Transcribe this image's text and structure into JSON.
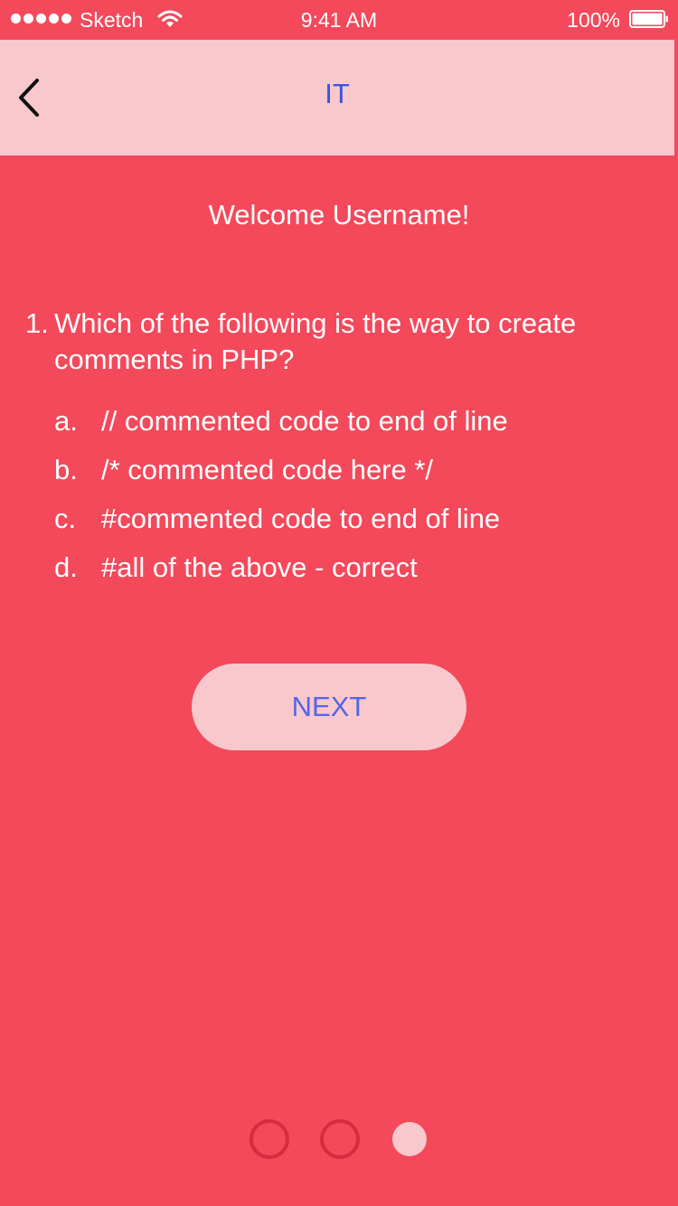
{
  "status_bar": {
    "carrier": "Sketch",
    "time": "9:41 AM",
    "battery_percent": "100%",
    "battery_level": 1.0,
    "signal_bars": 5
  },
  "nav": {
    "title": "IT",
    "back_icon": "chevron-left-icon"
  },
  "welcome": "Welcome Username!",
  "question": {
    "number": "1.",
    "line1": "Which of the following is the way to create",
    "line2": "comments in PHP?"
  },
  "options": [
    {
      "letter": "a.",
      "text": "// commented code to end of line"
    },
    {
      "letter": "b.",
      "text": "/* commented code here */"
    },
    {
      "letter": "c.",
      "text": "#commented code to end of line"
    },
    {
      "letter": "d.",
      "text": "#all of the above - correct"
    }
  ],
  "next_button": "NEXT",
  "pager": {
    "total": 3,
    "current": 3
  },
  "colors": {
    "background": "#f3495b",
    "nav_background": "#f9c8cc",
    "title_blue": "#3d52e0",
    "button_text": "#5466e6",
    "dot_outline": "#d92b3f",
    "dot_active": "#f9c8cc"
  }
}
